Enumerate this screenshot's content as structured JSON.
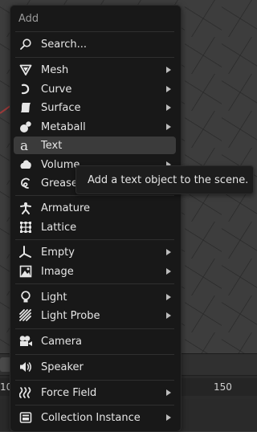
{
  "menu": {
    "title": "Add",
    "search_label": "Search...",
    "items": [
      {
        "label": "Mesh",
        "icon": "mesh-icon",
        "submenu": true
      },
      {
        "label": "Curve",
        "icon": "curve-icon",
        "submenu": true
      },
      {
        "label": "Surface",
        "icon": "surface-icon",
        "submenu": true
      },
      {
        "label": "Metaball",
        "icon": "metaball-icon",
        "submenu": true
      },
      {
        "label": "Text",
        "icon": "text-icon",
        "submenu": false,
        "active": true
      },
      {
        "label": "Volume",
        "icon": "volume-icon",
        "submenu": true
      },
      {
        "label": "Grease",
        "icon": "grease-pencil-icon",
        "submenu": true
      },
      {
        "label": "Armature",
        "icon": "armature-icon",
        "submenu": false
      },
      {
        "label": "Lattice",
        "icon": "lattice-icon",
        "submenu": false
      },
      {
        "label": "Empty",
        "icon": "empty-icon",
        "submenu": true
      },
      {
        "label": "Image",
        "icon": "image-icon",
        "submenu": true
      },
      {
        "label": "Light",
        "icon": "light-icon",
        "submenu": true
      },
      {
        "label": "Light Probe",
        "icon": "light-probe-icon",
        "submenu": true
      },
      {
        "label": "Camera",
        "icon": "camera-icon",
        "submenu": false
      },
      {
        "label": "Speaker",
        "icon": "speaker-icon",
        "submenu": false
      },
      {
        "label": "Force Field",
        "icon": "force-field-icon",
        "submenu": true
      },
      {
        "label": "Collection Instance",
        "icon": "collection-instance-icon",
        "submenu": true
      }
    ]
  },
  "tooltip": {
    "text": "Add a text object to the scene."
  },
  "timeline": {
    "frame_left": "10",
    "frame_right": "150"
  },
  "colors": {
    "menu_bg": "#181818",
    "active_bg": "#3b3b3b",
    "text": "#e6e6e6",
    "muted_text": "#9a9a9a"
  }
}
